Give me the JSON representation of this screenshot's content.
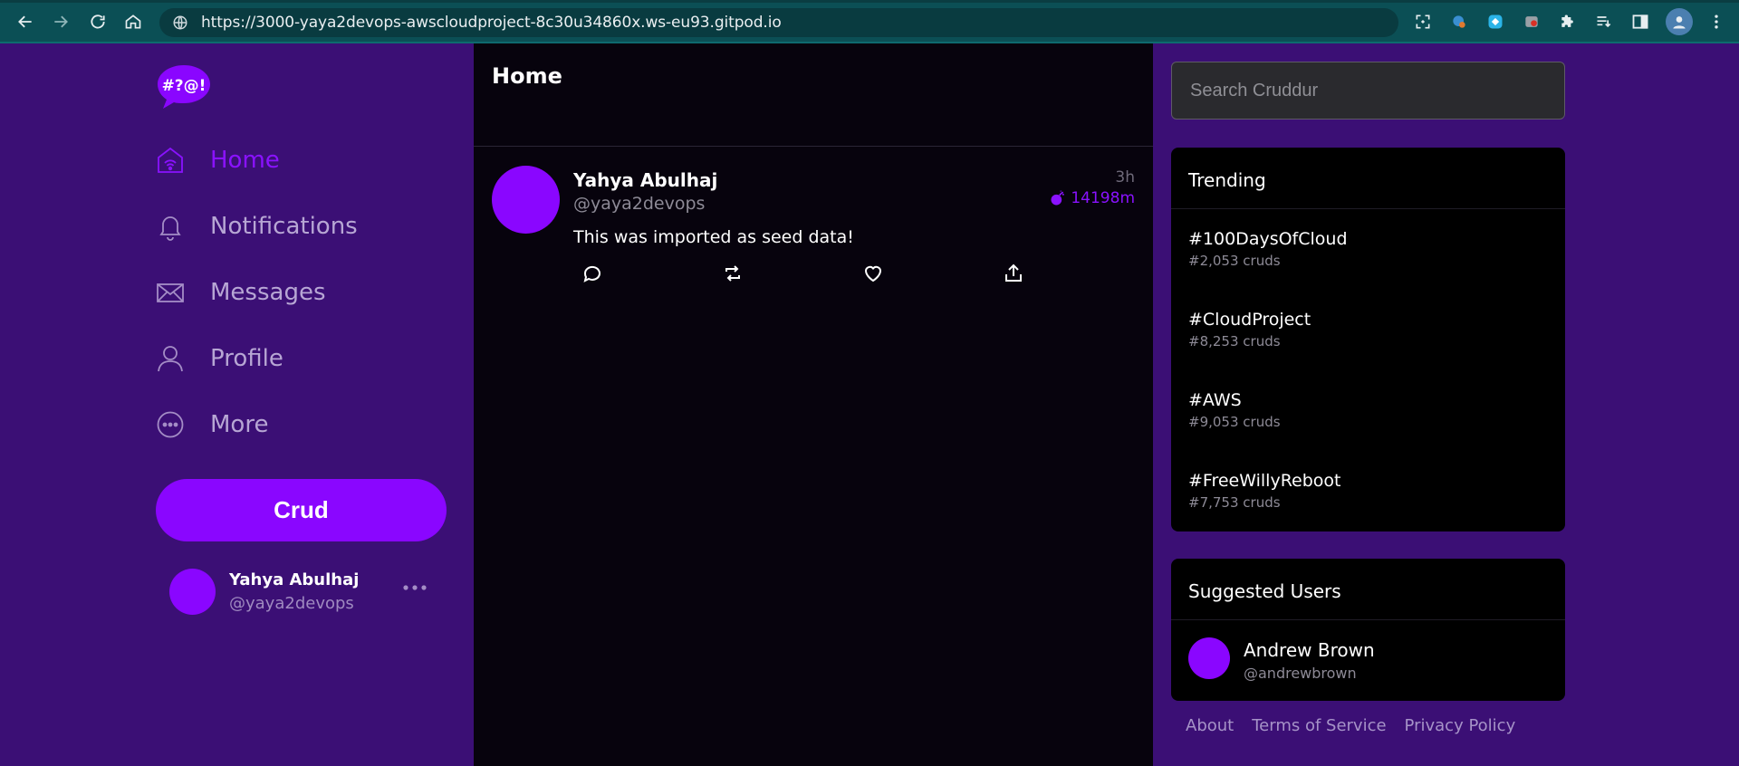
{
  "browser": {
    "url": "https://3000-yaya2devops-awscloudproject-8c30u34860x.ws-eu93.gitpod.io",
    "icons": [
      "back-icon",
      "forward-icon",
      "reload-icon",
      "home-icon",
      "site-info-icon",
      "screenshot-icon",
      "extension-icon",
      "extension-icon",
      "extension-icon",
      "puzzle-icon",
      "reading-list-icon",
      "side-panel-icon",
      "profile-avatar",
      "kebab-menu-icon"
    ]
  },
  "sidebar": {
    "logo_text": "#?@!",
    "items": [
      {
        "label": "Home",
        "icon": "home-icon",
        "active": true
      },
      {
        "label": "Notifications",
        "icon": "bell-icon"
      },
      {
        "label": "Messages",
        "icon": "envelope-icon"
      },
      {
        "label": "Profile",
        "icon": "user-icon"
      },
      {
        "label": "More",
        "icon": "more-circle-icon"
      }
    ],
    "crud_button": "Crud",
    "profile": {
      "name": "Yahya Abulhaj",
      "handle": "@yaya2devops"
    }
  },
  "main": {
    "title": "Home",
    "posts": [
      {
        "name": "Yahya Abulhaj",
        "handle": "@yaya2devops",
        "text": "This was imported as seed data!",
        "time": "3h",
        "expires": "14198m"
      }
    ]
  },
  "right": {
    "search_placeholder": "Search Cruddur",
    "trending": {
      "title": "Trending",
      "items": [
        {
          "tag": "#100DaysOfCloud",
          "count": "#2,053 cruds"
        },
        {
          "tag": "#CloudProject",
          "count": "#8,253 cruds"
        },
        {
          "tag": "#AWS",
          "count": "#9,053 cruds"
        },
        {
          "tag": "#FreeWillyReboot",
          "count": "#7,753 cruds"
        }
      ]
    },
    "suggested": {
      "title": "Suggested Users",
      "users": [
        {
          "name": "Andrew Brown",
          "handle": "@andrewbrown"
        }
      ]
    },
    "footer": [
      "About",
      "Terms of Service",
      "Privacy Policy"
    ]
  },
  "colors": {
    "accent": "#8a06ff",
    "sidebar_bg": "#3b0f75",
    "feed_bg": "#07030d",
    "chrome_bg": "#0b4f55"
  }
}
